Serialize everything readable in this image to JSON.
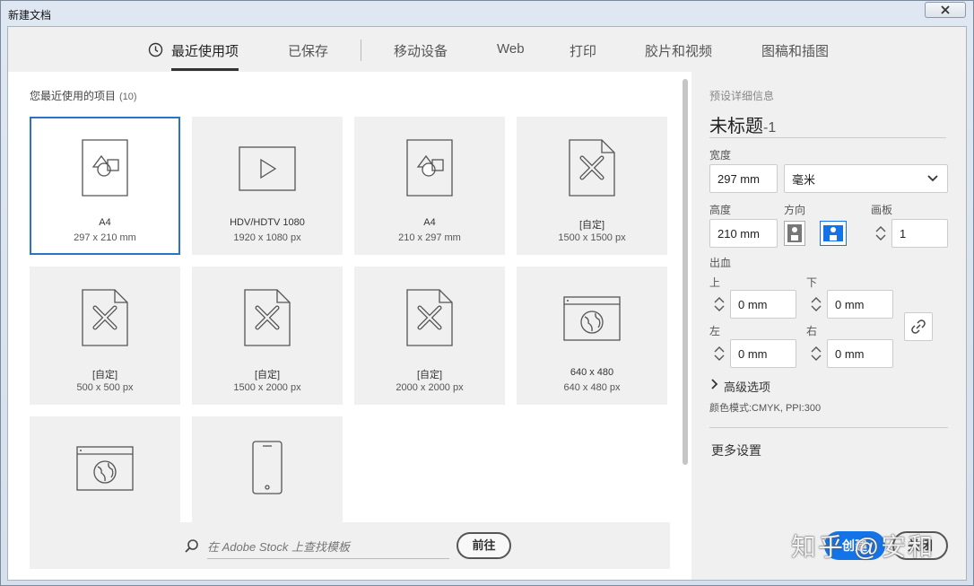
{
  "window": {
    "title": "新建文档"
  },
  "tabs": [
    {
      "label": "最近使用项"
    },
    {
      "label": "已保存"
    },
    {
      "label": "移动设备"
    },
    {
      "label": "Web"
    },
    {
      "label": "打印"
    },
    {
      "label": "胶片和视频"
    },
    {
      "label": "图稿和插图"
    }
  ],
  "recent": {
    "heading": "您最近使用的项目",
    "count": "(10)",
    "items": [
      {
        "name": "A4",
        "size": "297 x 210 mm",
        "icon": "print-document-icon"
      },
      {
        "name": "HDV/HDTV 1080",
        "size": "1920 x 1080 px",
        "icon": "video-play-icon"
      },
      {
        "name": "A4",
        "size": "210 x 297 mm",
        "icon": "print-document-icon"
      },
      {
        "name": "[自定]",
        "size": "1500 x 1500 px",
        "icon": "custom-document-icon"
      },
      {
        "name": "[自定]",
        "size": "500 x 500 px",
        "icon": "custom-document-icon"
      },
      {
        "name": "[自定]",
        "size": "1500 x 2000 px",
        "icon": "custom-document-icon"
      },
      {
        "name": "[自定]",
        "size": "2000 x 2000 px",
        "icon": "custom-document-icon"
      },
      {
        "name": "640 x 480",
        "size": "640 x 480 px",
        "icon": "web-globe-icon"
      },
      {
        "name": "",
        "size": "",
        "icon": "web-globe-icon"
      },
      {
        "name": "",
        "size": "",
        "icon": "mobile-phone-icon"
      }
    ]
  },
  "stock": {
    "placeholder": "在 Adobe Stock 上查找模板",
    "go_label": "前往"
  },
  "preset": {
    "section_title": "预设详细信息",
    "doc_name": "未标题",
    "doc_suffix": "-1",
    "width_label": "宽度",
    "width_value": "297 mm",
    "unit_value": "毫米",
    "height_label": "高度",
    "height_value": "210 mm",
    "orientation_label": "方向",
    "artboards_label": "画板",
    "artboards_value": "1",
    "bleed_label": "出血",
    "top_label": "上",
    "top_value": "0 mm",
    "bottom_label": "下",
    "bottom_value": "0 mm",
    "left_label": "左",
    "left_value": "0 mm",
    "right_label": "右",
    "right_value": "0 mm",
    "advanced_label": "高级选项",
    "color_mode": "颜色模式:CMYK, PPI:300",
    "more_settings": "更多设置"
  },
  "actions": {
    "create_label": "创建",
    "close_label": "关闭"
  },
  "watermark": {
    "text": "知乎 @安和"
  },
  "colors": {
    "accent": "#1473e6",
    "selected_border": "#2b73c9"
  }
}
